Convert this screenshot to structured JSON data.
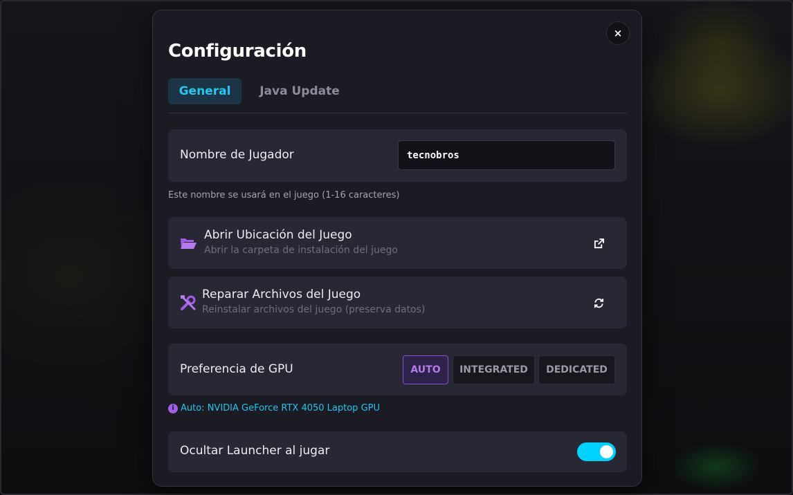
{
  "modal": {
    "title": "Configuración",
    "close_label": "×"
  },
  "tabs": [
    {
      "label": "General",
      "active": true
    },
    {
      "label": "Java Update",
      "active": false
    }
  ],
  "player_name": {
    "label": "Nombre de Jugador",
    "value": "tecnobros",
    "hint": "Este nombre se usará en el juego (1-16 caracteres)"
  },
  "open_location": {
    "title": "Abrir Ubicación del Juego",
    "subtitle": "Abrir la carpeta de instalación del juego",
    "icon": "folder-open-icon",
    "action_icon": "external-link-icon"
  },
  "repair_files": {
    "title": "Reparar Archivos del Juego",
    "subtitle": "Reinstalar archivos del juego (preserva datos)",
    "icon": "tools-icon",
    "action_icon": "refresh-icon"
  },
  "gpu": {
    "label": "Preferencia de GPU",
    "options": [
      "AUTO",
      "INTEGRATED",
      "DEDICATED"
    ],
    "selected": "AUTO",
    "info_icon": "info-icon",
    "info": "Auto: NVIDIA GeForce RTX 4050 Laptop GPU"
  },
  "hide_launcher": {
    "label": "Ocultar Launcher al jugar",
    "enabled": true
  },
  "colors": {
    "accent_cyan": "#00d2ff",
    "accent_purple": "#a35ee8",
    "modal_bg": "#1b1b24",
    "card_bg": "#282834"
  }
}
